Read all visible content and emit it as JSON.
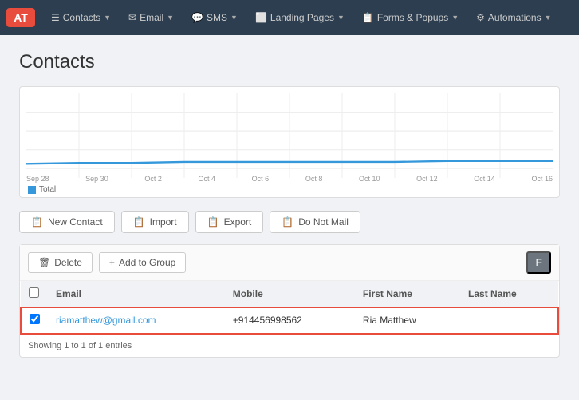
{
  "brand": {
    "initials": "AT",
    "bg_color": "#e74c3c"
  },
  "navbar": {
    "items": [
      {
        "id": "contacts",
        "label": "Contacts",
        "icon": "👤",
        "has_dropdown": true
      },
      {
        "id": "email",
        "label": "Email",
        "icon": "✉",
        "has_dropdown": true
      },
      {
        "id": "sms",
        "label": "SMS",
        "icon": "💬",
        "has_dropdown": true
      },
      {
        "id": "landing-pages",
        "label": "Landing Pages",
        "icon": "📄",
        "has_dropdown": true
      },
      {
        "id": "forms-popups",
        "label": "Forms & Popups",
        "icon": "📋",
        "has_dropdown": true
      },
      {
        "id": "automations",
        "label": "Automations",
        "icon": "⚙",
        "has_dropdown": true
      }
    ]
  },
  "page": {
    "title": "Contacts"
  },
  "chart": {
    "legend_label": "Total",
    "x_labels": [
      "Sep 28",
      "Sep 30",
      "Oct 2",
      "Oct 4",
      "Oct 6",
      "Oct 8",
      "Oct 10",
      "Oct 12",
      "Oct 14",
      "Oct 16"
    ]
  },
  "action_buttons": [
    {
      "id": "new-contact",
      "label": "New Contact",
      "icon": "+"
    },
    {
      "id": "import",
      "label": "Import",
      "icon": "⬆"
    },
    {
      "id": "export",
      "label": "Export",
      "icon": "⬇"
    },
    {
      "id": "do-not-mail",
      "label": "Do Not Mail",
      "icon": "🚫"
    }
  ],
  "toolbar": {
    "delete_label": "Delete",
    "add_group_label": "Add to Group",
    "filter_label": "F"
  },
  "table": {
    "columns": [
      "Email",
      "Mobile",
      "First Name",
      "Last Name"
    ],
    "rows": [
      {
        "id": "row-1",
        "selected": true,
        "email": "riamatthew@gmail.com",
        "mobile": "+914456998562",
        "first_name": "Ria Matthew",
        "last_name": ""
      }
    ]
  },
  "pagination": {
    "showing_text": "Showing 1 to 1 of 1 entries"
  }
}
